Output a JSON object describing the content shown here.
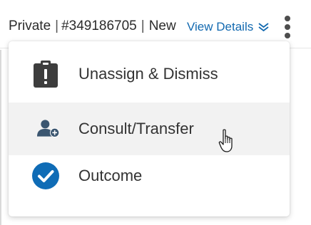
{
  "header": {
    "privacy": "Private",
    "separator": "|",
    "case_number": "#349186705",
    "separator2": "|",
    "status": "New",
    "view_details_label": "View Details",
    "view_details_icon": "double-chevron-down-icon",
    "more_icon": "vertical-ellipsis-icon"
  },
  "menu": {
    "items": [
      {
        "label": "Unassign & Dismiss",
        "icon": "clipboard-alert-icon",
        "highlighted": false
      },
      {
        "label": "Consult/Transfer",
        "icon": "add-user-icon",
        "highlighted": true
      },
      {
        "label": "Outcome",
        "icon": "check-circle-icon",
        "highlighted": false
      }
    ]
  },
  "colors": {
    "link": "#1269b0",
    "icon_dark": "#3d3d3d",
    "add_user_blue": "#3b5670",
    "check_blue": "#0f6cb6",
    "hover_bg": "#f2f2f2"
  },
  "cursor": "hand-pointer-icon"
}
